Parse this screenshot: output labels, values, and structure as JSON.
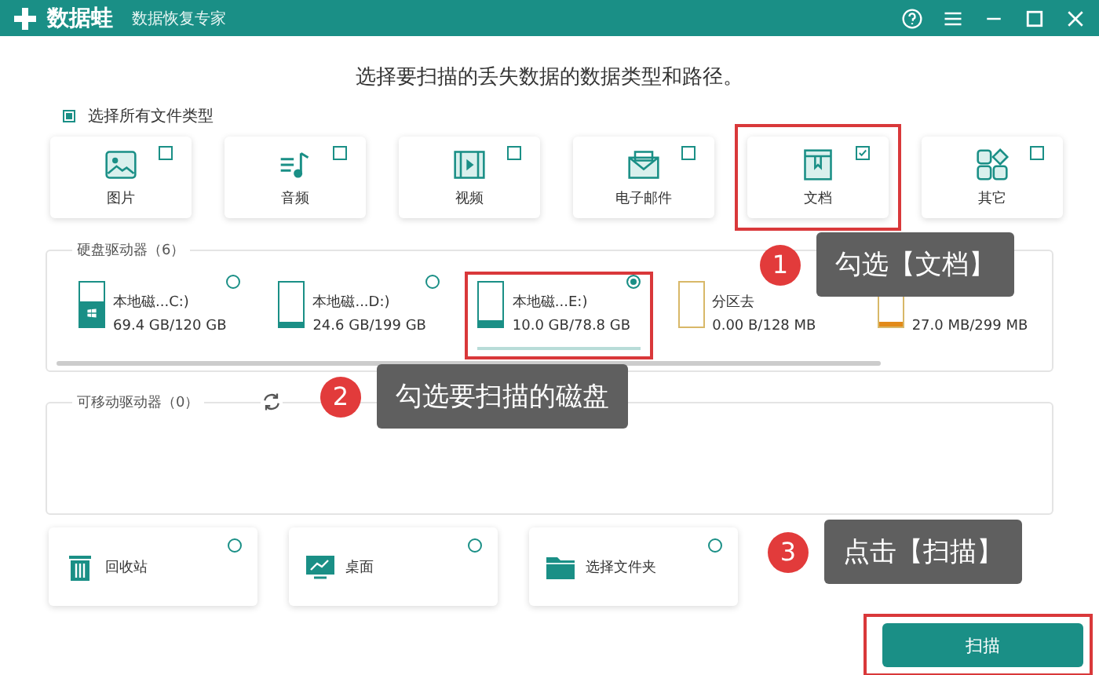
{
  "window": {
    "app_name": "数据蛙",
    "subtitle": "数据恢复专家"
  },
  "heading": "选择要扫描的丢失数据的数据类型和路径。",
  "select_all": {
    "label": "选择所有文件类型",
    "checked": true
  },
  "file_types": [
    {
      "label": "图片",
      "kind": "image",
      "checked": false,
      "highlighted": false
    },
    {
      "label": "音频",
      "kind": "audio",
      "checked": false,
      "highlighted": false
    },
    {
      "label": "视频",
      "kind": "video",
      "checked": false,
      "highlighted": false
    },
    {
      "label": "电子邮件",
      "kind": "mail",
      "checked": false,
      "highlighted": false
    },
    {
      "label": "文档",
      "kind": "doc",
      "checked": true,
      "highlighted": true
    },
    {
      "label": "其它",
      "kind": "other",
      "checked": false,
      "highlighted": false
    }
  ],
  "hard_drives": {
    "label": "硬盘驱动器（6）",
    "drives": [
      {
        "name": "本地磁...C:)",
        "usage": "69.4 GB/120 GB",
        "level": 0.58,
        "kind": "system",
        "selected": false,
        "highlighted": false
      },
      {
        "name": "本地磁...D:)",
        "usage": "24.6 GB/199 GB",
        "level": 0.12,
        "kind": "disk",
        "selected": false,
        "highlighted": false
      },
      {
        "name": "本地磁...E:)",
        "usage": "10.0 GB/78.8 GB",
        "level": 0.13,
        "kind": "disk",
        "selected": true,
        "highlighted": true
      },
      {
        "name": "分区去",
        "usage": "0.00  B/128 MB",
        "kind": "partition",
        "highlighted": false
      },
      {
        "usage": "27.0 MB/299 MB",
        "level": 0.09,
        "kind": "partition",
        "highlighted": false
      }
    ]
  },
  "removable": {
    "label": "可移动驱动器（0）"
  },
  "locations": [
    {
      "label": "回收站",
      "kind": "trash",
      "selected": false
    },
    {
      "label": "桌面",
      "kind": "desktop",
      "selected": false
    },
    {
      "label": "选择文件夹",
      "kind": "folder",
      "selected": false
    }
  ],
  "scan_button": {
    "label": "扫描",
    "highlighted": true
  },
  "callouts": [
    {
      "number": "1",
      "text": "勾选【文档】"
    },
    {
      "number": "2",
      "text": "勾选要扫描的磁盘"
    },
    {
      "number": "3",
      "text": "点击【扫描】"
    }
  ]
}
